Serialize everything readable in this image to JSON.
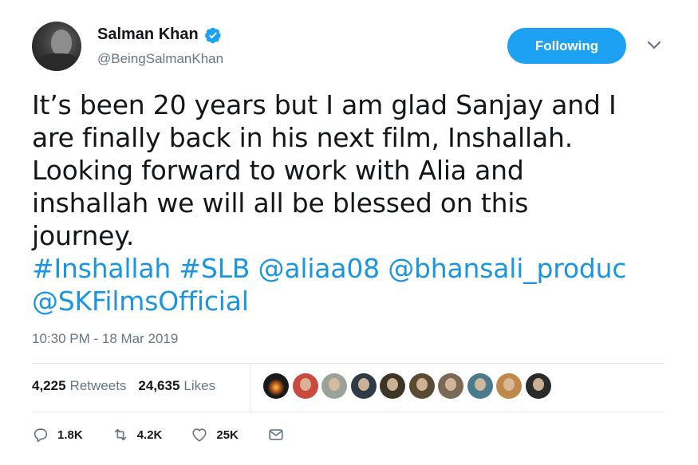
{
  "user": {
    "name": "Salman Khan",
    "handle": "@BeingSalmanKhan",
    "verified": true
  },
  "follow_button": {
    "label": "Following"
  },
  "tweet": {
    "lines": [
      "It’s been 20 years but I am glad Sanjay and I",
      "are finally back in his next film, Inshallah.",
      "Looking forward to work with Alia and",
      "inshallah we will all be blessed on this",
      "journey."
    ],
    "links_line1": [
      "#Inshallah",
      "#SLB",
      "@aliaa08",
      "@bhansali_produc"
    ],
    "links_line2": [
      "@SKFilmsOfficial"
    ]
  },
  "timestamp": "10:30 PM - 18 Mar 2019",
  "stats": {
    "retweets_count": "4,225",
    "retweets_label": "Retweets",
    "likes_count": "24,635",
    "likes_label": "Likes"
  },
  "actions": {
    "reply_count": "1.8K",
    "retweet_count": "4.2K",
    "like_count": "25K"
  },
  "colors": {
    "accent": "#1da1f2",
    "link": "#1b95e0",
    "muted": "#657786",
    "text": "#14171a",
    "divider": "#e1e8ed"
  },
  "icons": [
    "verified-badge-icon",
    "chevron-down-icon",
    "reply-icon",
    "retweet-icon",
    "like-icon",
    "direct-message-icon"
  ]
}
